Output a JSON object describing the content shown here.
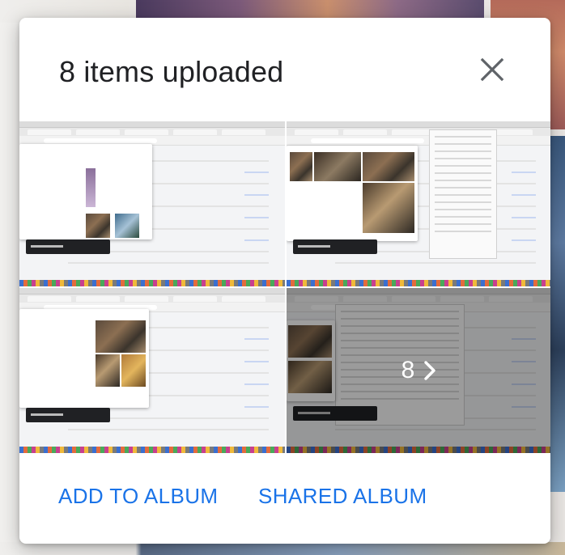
{
  "dialog": {
    "title": "8 items uploaded",
    "close_icon": "close-icon"
  },
  "thumbnails": {
    "count": 4,
    "remaining_label": "8",
    "next_icon": "chevron-right-icon"
  },
  "actions": {
    "add_to_album": "ADD TO ALBUM",
    "shared_album": "SHARED ALBUM"
  },
  "colors": {
    "accent": "#1a73e8",
    "title": "#202124",
    "icon": "#5f6368"
  }
}
